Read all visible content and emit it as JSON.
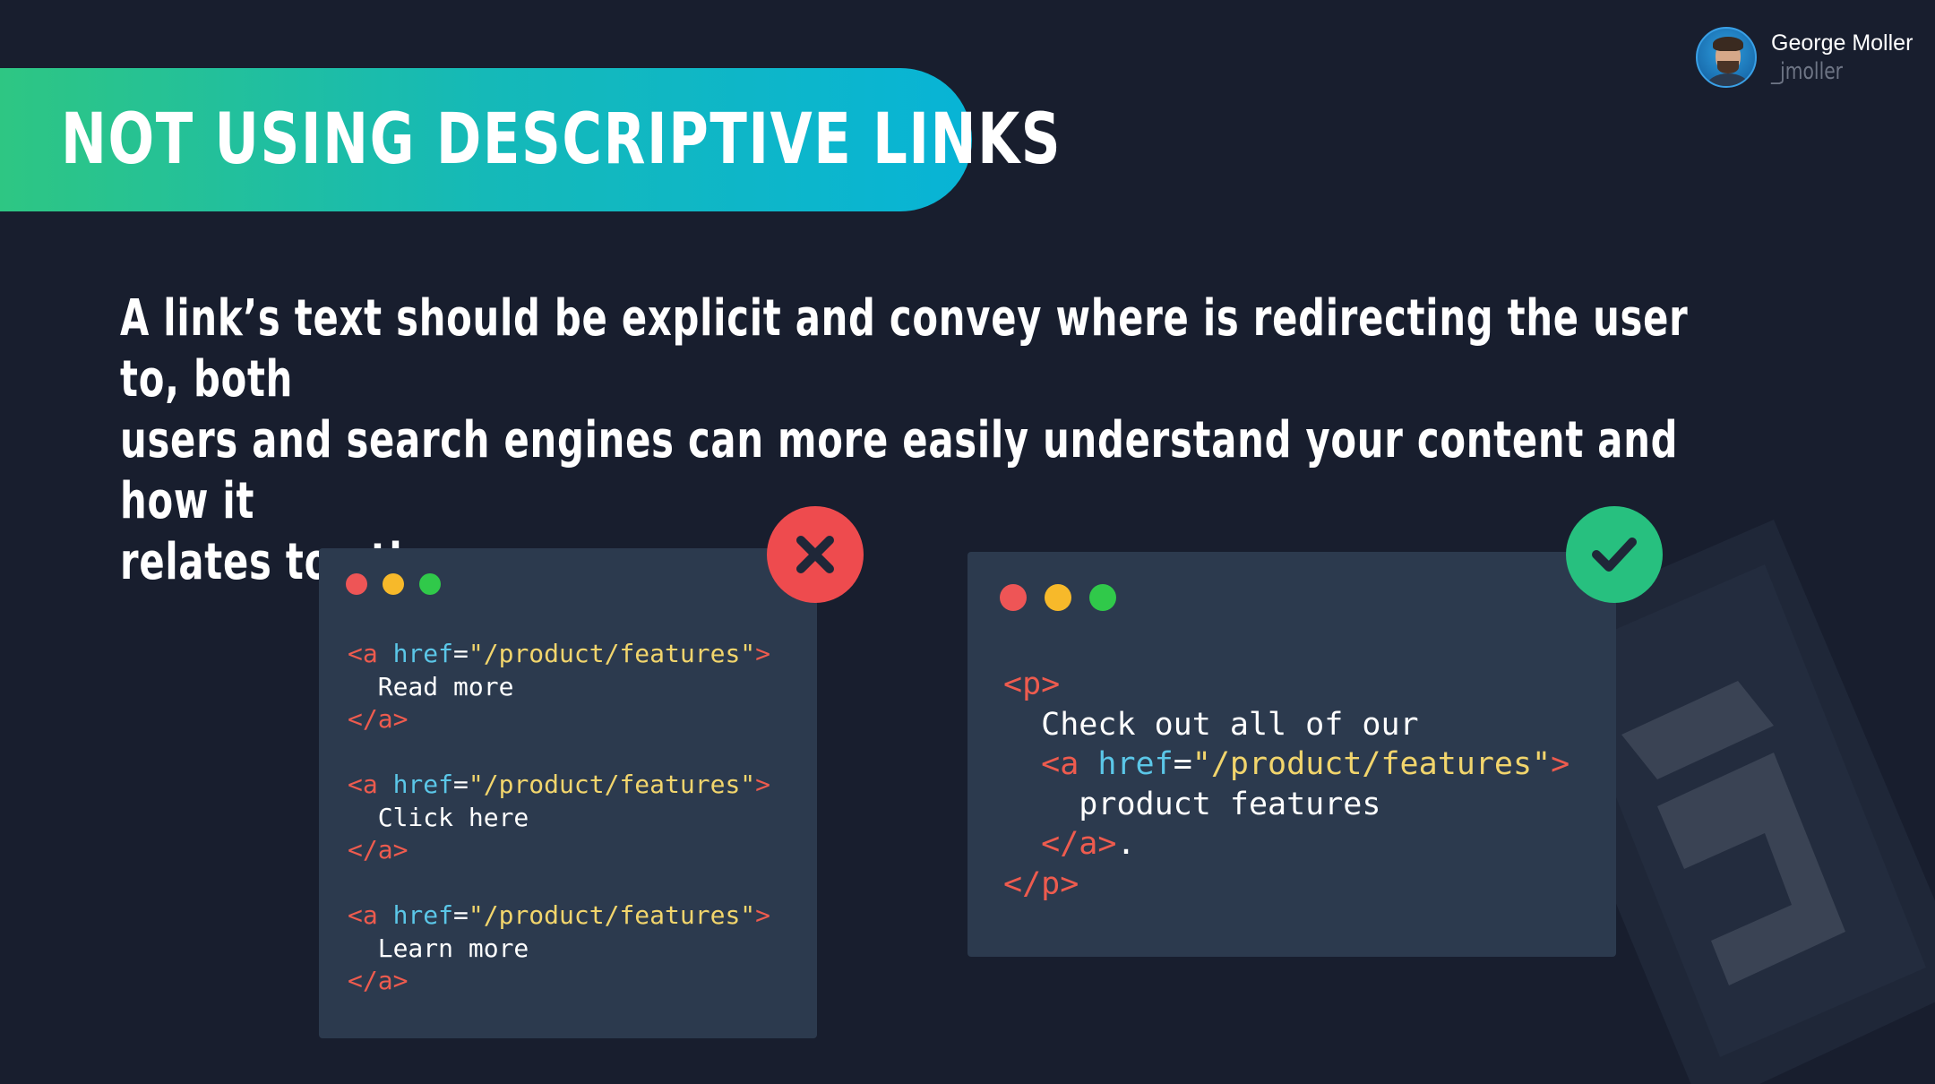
{
  "title": "NOT USING DESCRIPTIVE LINKS",
  "author": {
    "name": "George Moller",
    "handle": "_jmoller"
  },
  "description": {
    "line1": "A link’s text should be explicit and convey where is redirecting the user to, both",
    "line2": "users and search engines can more easily understand your content and how it",
    "line3": "relates to other pages."
  },
  "bad_example": {
    "status_icon": "x-icon",
    "blocks": [
      {
        "open_tag": "<a",
        "attr": "href",
        "eq": "=",
        "value": "\"/product/features\"",
        "close_bracket": ">",
        "text": "Read more",
        "end_tag": "</a>"
      },
      {
        "open_tag": "<a",
        "attr": "href",
        "eq": "=",
        "value": "\"/product/features\"",
        "close_bracket": ">",
        "text": "Click here",
        "end_tag": "</a>"
      },
      {
        "open_tag": "<a",
        "attr": "href",
        "eq": "=",
        "value": "\"/product/features\"",
        "close_bracket": ">",
        "text": "Learn more",
        "end_tag": "</a>"
      }
    ]
  },
  "good_example": {
    "status_icon": "check-icon",
    "p_open": "<p>",
    "text_before": "Check out all of our",
    "a_open": "<a",
    "attr": "href",
    "eq": "=",
    "value": "\"/product/features\"",
    "close_bracket": ">",
    "link_text": "product features",
    "a_close": "</a>",
    "period": ".",
    "p_close": "</p>"
  },
  "colors": {
    "background": "#181e2e",
    "banner_start": "#2ec683",
    "banner_end": "#08b4d6",
    "code_bg": "#2c3a4e",
    "tag": "#ee5b4e",
    "attr": "#5bc7e8",
    "string": "#f2d56c",
    "bad": "#ee4b4e",
    "good": "#27c07f"
  }
}
